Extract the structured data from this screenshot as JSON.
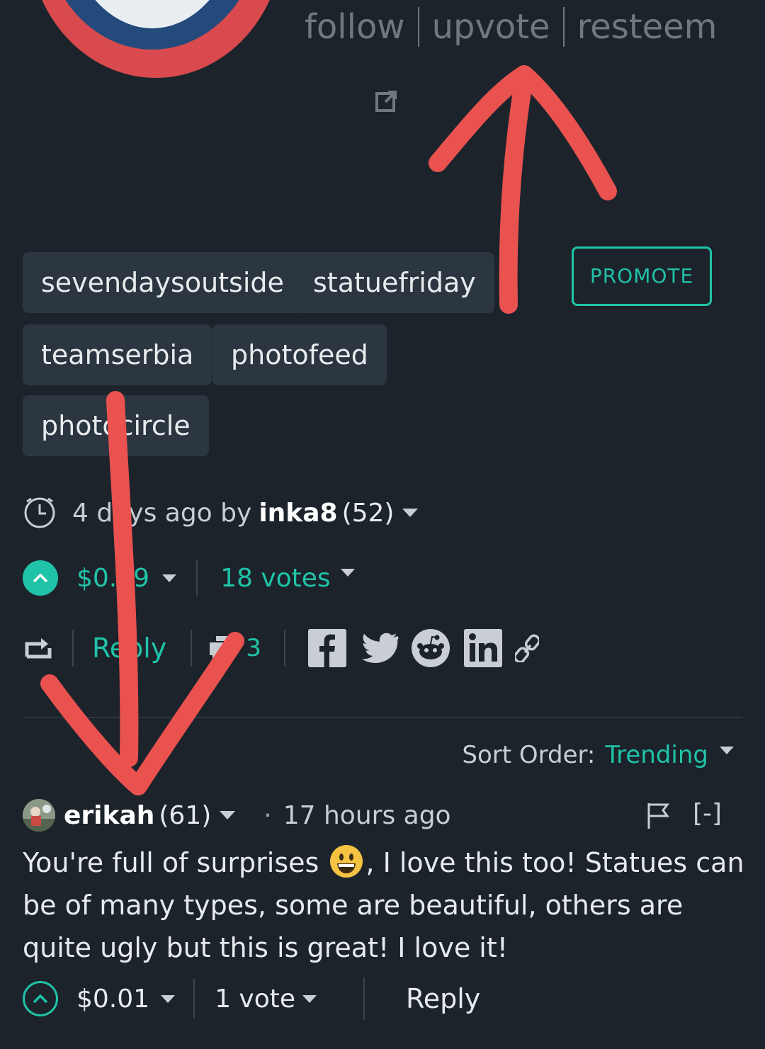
{
  "header": {
    "links": [
      "follow",
      "upvote",
      "resteem"
    ]
  },
  "tags": [
    "sevendaysoutside",
    "statuefriday",
    "teamserbia",
    "photofeed",
    "photocircle"
  ],
  "promote_label": "PROMOTE",
  "post_meta": {
    "time": "4 days ago by",
    "author": "inka8",
    "reputation": "(52)"
  },
  "post_payout": {
    "amount": "$0.09",
    "votes": "18 votes"
  },
  "post_actions": {
    "reply": "Reply",
    "comments_count": "3"
  },
  "sort": {
    "label": "Sort Order:",
    "value": "Trending"
  },
  "comment": {
    "author": "erikah",
    "reputation": "(61)",
    "time": "17 hours ago",
    "collapse": "[-]",
    "body_before_emoji": "You're full of surprises ",
    "body_after_emoji": ", I love this too! Statues can be of many types, some are beautiful, others are quite ugly but this is great! I love it!",
    "payout": "$0.01",
    "votes": "1 vote",
    "reply": "Reply"
  },
  "colors": {
    "background": "#1c232b",
    "accent": "#20c3a8",
    "tag_bg": "#2c3640",
    "annotation": "#e9524f"
  }
}
